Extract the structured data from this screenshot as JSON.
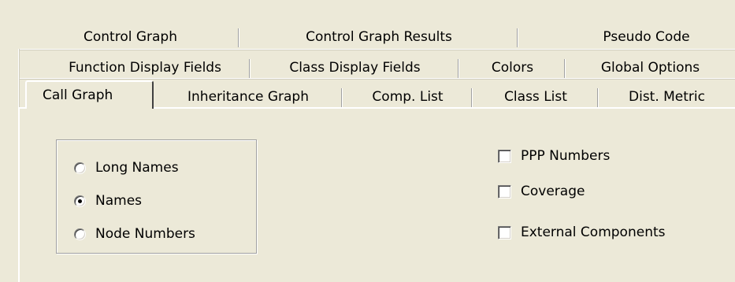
{
  "tabs": {
    "row1": [
      "Control Graph",
      "Control Graph Results",
      "Pseudo Code"
    ],
    "row2": [
      "Function Display Fields",
      "Class Display Fields",
      "Colors",
      "Global Options"
    ],
    "row3": [
      "Call Graph",
      "Inheritance Graph",
      "Comp. List",
      "Class List",
      "Dist. Metric"
    ],
    "active": "Call Graph"
  },
  "name_options": {
    "items": [
      "Long Names",
      "Names",
      "Node Numbers"
    ],
    "selected": "Names"
  },
  "display_options": {
    "items": [
      "PPP Numbers",
      "Coverage",
      "External Components"
    ],
    "checked": [
      false,
      false,
      false
    ]
  },
  "colors": {
    "face": "#ece9d8",
    "highlight": "#ffffff",
    "shadow": "#a0a0a0"
  }
}
